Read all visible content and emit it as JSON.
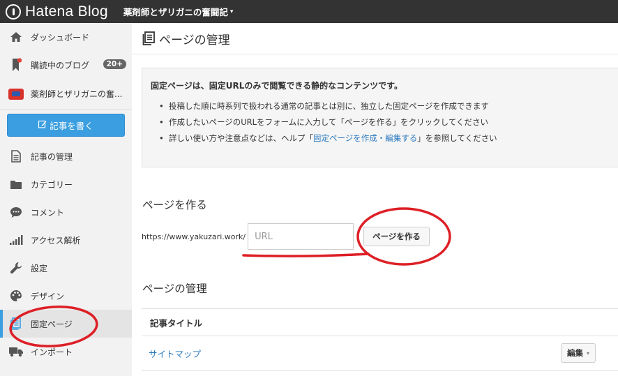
{
  "topbar": {
    "logo": "Hatena Blog",
    "blog_name": "薬剤師とザリガニの奮闘記",
    "blog_caret": "▾"
  },
  "sidebar": {
    "dashboard": "ダッシュボード",
    "subscriptions": "購読中のブログ",
    "subscriptions_badge": "20+",
    "blog_name": "薬剤師とザリガニの奮...",
    "write_button": "記事を書く",
    "items": [
      {
        "label": "記事の管理",
        "icon": "document-icon"
      },
      {
        "label": "カテゴリー",
        "icon": "folder-icon"
      },
      {
        "label": "コメント",
        "icon": "comment-icon"
      },
      {
        "label": "アクセス解析",
        "icon": "bar-chart-icon"
      },
      {
        "label": "設定",
        "icon": "wrench-icon"
      },
      {
        "label": "デザイン",
        "icon": "palette-icon"
      },
      {
        "label": "固定ページ",
        "icon": "page-icon",
        "active": true
      },
      {
        "label": "インポート",
        "icon": "truck-icon"
      }
    ]
  },
  "main": {
    "title": "ページの管理",
    "info": {
      "heading": "固定ページは、固定URLのみで閲覧できる静的なコンテンツです。",
      "bullet1": "投稿した順に時系列で扱われる通常の記事とは別に、独立した固定ページを作成できます",
      "bullet2": "作成したいページのURLをフォームに入力して「ページを作る」をクリックしてください",
      "bullet3_pre": "詳しい使い方や注意点などは、ヘルプ「",
      "bullet3_link": "固定ページを作成・編集する",
      "bullet3_post": "」を参照してください"
    },
    "create_section": {
      "title": "ページを作る",
      "url_prefix": "https://www.yakuzari.work/",
      "url_placeholder": "URL",
      "button": "ページを作る"
    },
    "manage_section": {
      "title": "ページの管理",
      "column_title": "記事タイトル",
      "rows": [
        {
          "title": "サイトマップ",
          "action": "編集"
        }
      ]
    }
  },
  "colors": {
    "topbar_bg": "#333333",
    "accent_blue": "#3a9ee0",
    "annotation_red": "#dd1f26"
  }
}
